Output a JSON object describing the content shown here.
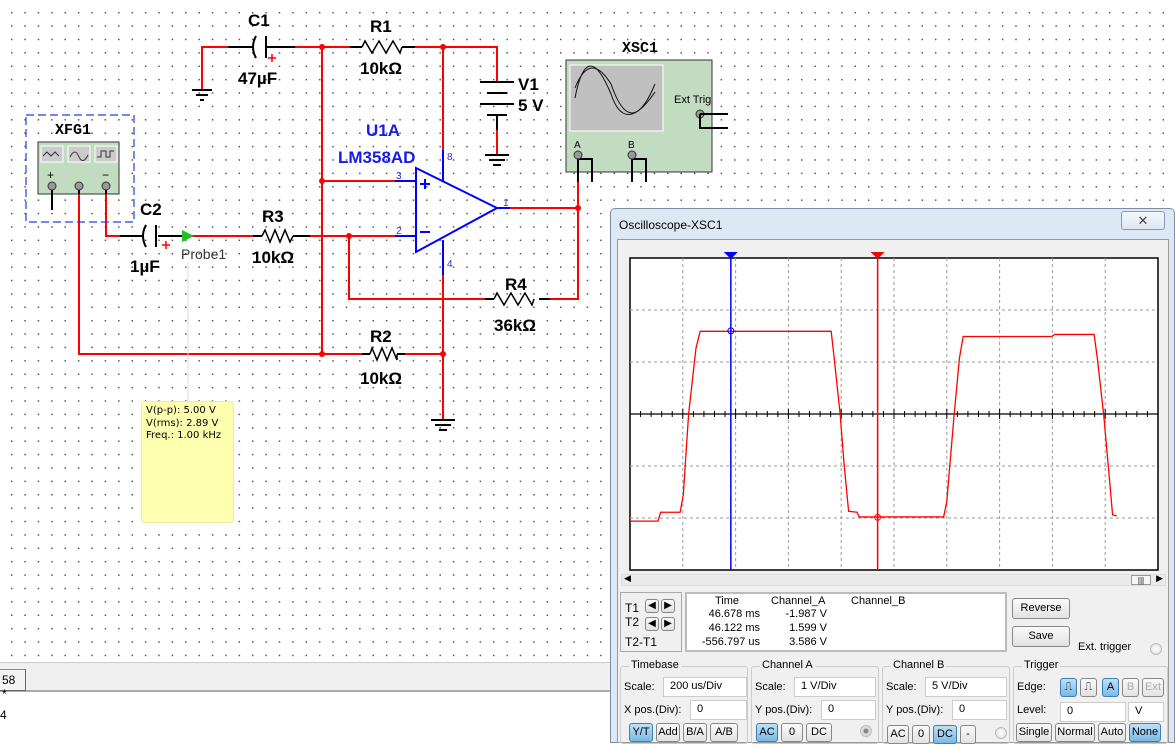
{
  "schematic": {
    "c1": {
      "name": "C1",
      "value": "47µF"
    },
    "r1": {
      "name": "R1",
      "value": "10kΩ"
    },
    "v1": {
      "name": "V1",
      "value": "5 V"
    },
    "xsc1": {
      "name": "XSC1",
      "ext_trig": "Ext Trig",
      "ch_a": "A",
      "ch_b": "B"
    },
    "u1a": {
      "name": "U1A",
      "part": "LM358AD",
      "pins": [
        "8",
        "3",
        "2",
        "1",
        "4"
      ]
    },
    "xfg1": {
      "name": "XFG1"
    },
    "c2": {
      "name": "C2",
      "value": "1µF"
    },
    "probe": {
      "name": "Probe1"
    },
    "r3": {
      "name": "R3",
      "value": "10kΩ"
    },
    "r4": {
      "name": "R4",
      "value": "36kΩ"
    },
    "r2": {
      "name": "R2",
      "value": "10kΩ"
    },
    "wire_color": "#ff0000",
    "opamp_color": "#0000ff"
  },
  "probe_tip": {
    "vpp": "V(p-p): 5.00 V",
    "vrms": "V(rms): 2.89 V",
    "freq": "Freq.: 1.00 kHz"
  },
  "tab": {
    "label": "58 *"
  },
  "status": {
    "text": "4"
  },
  "scope": {
    "title": "Oscilloscope-XSC1",
    "close": "✕",
    "readout": {
      "headers": [
        "Time",
        "Channel_A",
        "Channel_B"
      ],
      "rows": [
        {
          "label": "T1",
          "time": "46.678 ms",
          "a": "-1.987 V",
          "b": ""
        },
        {
          "label": "T2",
          "time": "46.122 ms",
          "a": "1.599 V",
          "b": ""
        },
        {
          "label": "T2-T1",
          "time": "-556.797 us",
          "a": "3.586 V",
          "b": ""
        }
      ]
    },
    "reverse": "Reverse",
    "save": "Save",
    "ext_trigger": "Ext. trigger",
    "timebase": {
      "title": "Timebase",
      "scale_label": "Scale:",
      "scale": "200 us/Div",
      "xpos_label": "X pos.(Div):",
      "xpos": "0",
      "modes": [
        "Y/T",
        "Add",
        "B/A",
        "A/B"
      ],
      "active": "Y/T"
    },
    "channel_a": {
      "title": "Channel A",
      "scale_label": "Scale:",
      "scale": "1  V/Div",
      "ypos_label": "Y pos.(Div):",
      "ypos": "0",
      "coupling": [
        "AC",
        "0",
        "DC"
      ],
      "active": "AC"
    },
    "channel_b": {
      "title": "Channel B",
      "scale_label": "Scale:",
      "scale": "5  V/Div",
      "ypos_label": "Y pos.(Div):",
      "ypos": "0",
      "coupling": [
        "AC",
        "0",
        "DC",
        "-"
      ],
      "active": "DC"
    },
    "trigger": {
      "title": "Trigger",
      "edge_label": "Edge:",
      "sources": [
        "A",
        "B",
        "Ext"
      ],
      "active_source": "A",
      "level_label": "Level:",
      "level": "0",
      "level_unit": "V",
      "modes": [
        "Single",
        "Normal",
        "Auto",
        "None"
      ],
      "active_mode": "None"
    }
  },
  "chart_data": {
    "type": "line",
    "x_divisions": 10,
    "y_divisions": 6,
    "timebase_us_per_div": 200,
    "volts_per_div": 1,
    "ylim": [
      -3,
      3
    ],
    "xlim_us": [
      0,
      2000
    ],
    "grid": true,
    "series": [
      {
        "color": "#ff0000",
        "points": [
          [
            0,
            -2.06
          ],
          [
            106,
            -2.06
          ],
          [
            116,
            -1.89
          ],
          [
            190,
            -1.89
          ],
          [
            202,
            -1.55
          ],
          [
            222,
            0
          ],
          [
            250,
            1.27
          ],
          [
            266,
            1.59
          ],
          [
            762,
            1.59
          ],
          [
            772,
            1.14
          ],
          [
            796,
            0
          ],
          [
            810,
            -0.91
          ],
          [
            828,
            -1.87
          ],
          [
            860,
            -1.89
          ],
          [
            868,
            -1.98
          ],
          [
            1188,
            -1.98
          ],
          [
            1200,
            -1.68
          ],
          [
            1228,
            0
          ],
          [
            1248,
            1.08
          ],
          [
            1262,
            1.49
          ],
          [
            1596,
            1.49
          ],
          [
            1610,
            1.53
          ],
          [
            1758,
            1.53
          ],
          [
            1770,
            1.08
          ],
          [
            1794,
            0
          ],
          [
            1818,
            -1.36
          ],
          [
            1828,
            -1.94
          ],
          [
            1844,
            -1.96
          ]
        ]
      }
    ],
    "cursors": [
      {
        "name": "T1",
        "time_us": 938,
        "value": -1.987,
        "color": "#ff0000"
      },
      {
        "name": "T2",
        "time_us": 382,
        "value": 1.599,
        "color": "#0000ff"
      }
    ]
  }
}
